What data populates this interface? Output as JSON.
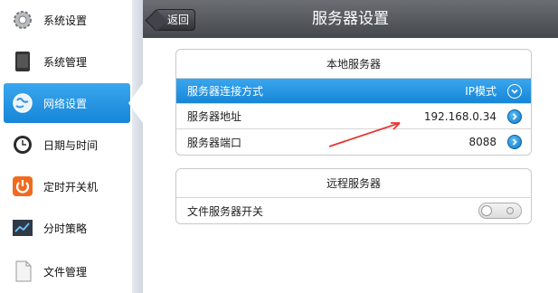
{
  "sidebar": {
    "items": [
      {
        "label": "系统设置",
        "icon": "gear-icon"
      },
      {
        "label": "系统管理",
        "icon": "tablet-icon"
      },
      {
        "label": "网络设置",
        "icon": "globe-icon",
        "active": true
      },
      {
        "label": "日期与时间",
        "icon": "clock-icon"
      },
      {
        "label": "定时开关机",
        "icon": "power-icon"
      },
      {
        "label": "分时策略",
        "icon": "chart-icon"
      },
      {
        "label": "文件管理",
        "icon": "document-icon"
      }
    ]
  },
  "header": {
    "back_label": "返回",
    "title": "服务器设置"
  },
  "local_server": {
    "heading": "本地服务器",
    "rows": [
      {
        "label": "服务器连接方式",
        "value": "IP模式"
      },
      {
        "label": "服务器地址",
        "value": "192.168.0.34"
      },
      {
        "label": "服务器端口",
        "value": "8088"
      }
    ]
  },
  "remote_server": {
    "heading": "远程服务器",
    "rows": [
      {
        "label": "文件服务器开关",
        "toggle": "off"
      }
    ]
  },
  "colors": {
    "accent": "#1e90e0",
    "titlebar": "#4f5257",
    "annotation": "#e53935"
  }
}
